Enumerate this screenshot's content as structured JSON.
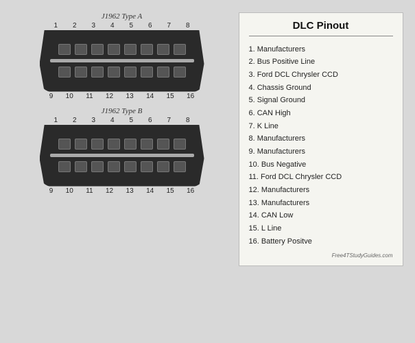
{
  "connectors": [
    {
      "title": "J1962 Type A",
      "top_pins": [
        "1",
        "2",
        "3",
        "4",
        "5",
        "6",
        "7",
        "8"
      ],
      "bottom_pins": [
        "9",
        "10",
        "11",
        "12",
        "13",
        "14",
        "15",
        "16"
      ],
      "id": "type-a"
    },
    {
      "title": "J1962 Type B",
      "top_pins": [
        "1",
        "2",
        "3",
        "4",
        "5",
        "6",
        "7",
        "8"
      ],
      "bottom_pins": [
        "9",
        "10",
        "11",
        "12",
        "13",
        "14",
        "15",
        "16"
      ],
      "id": "type-b"
    }
  ],
  "pinout": {
    "title": "DLC Pinout",
    "items": [
      {
        "num": "1.",
        "label": "Manufacturers"
      },
      {
        "num": "2.",
        "label": "Bus Positive Line"
      },
      {
        "num": "3.",
        "label": "Ford DCL Chrysler CCD"
      },
      {
        "num": "4.",
        "label": "Chassis Ground"
      },
      {
        "num": "5.",
        "label": "Signal Ground"
      },
      {
        "num": "6.",
        "label": "CAN High"
      },
      {
        "num": "7.",
        "label": "K Line"
      },
      {
        "num": "8.",
        "label": "Manufacturers"
      },
      {
        "num": "9.",
        "label": "Manufacturers"
      },
      {
        "num": "10.",
        "label": "Bus Negative"
      },
      {
        "num": "11.",
        "label": "Ford DCL Chrysler CCD"
      },
      {
        "num": "12.",
        "label": "Manufacturers"
      },
      {
        "num": "13.",
        "label": "Manufacturers"
      },
      {
        "num": "14.",
        "label": "CAN Low"
      },
      {
        "num": "15.",
        "label": "L Line"
      },
      {
        "num": "16.",
        "label": "Battery Positve"
      }
    ],
    "watermark": "Free4TStudyGuides.com"
  }
}
